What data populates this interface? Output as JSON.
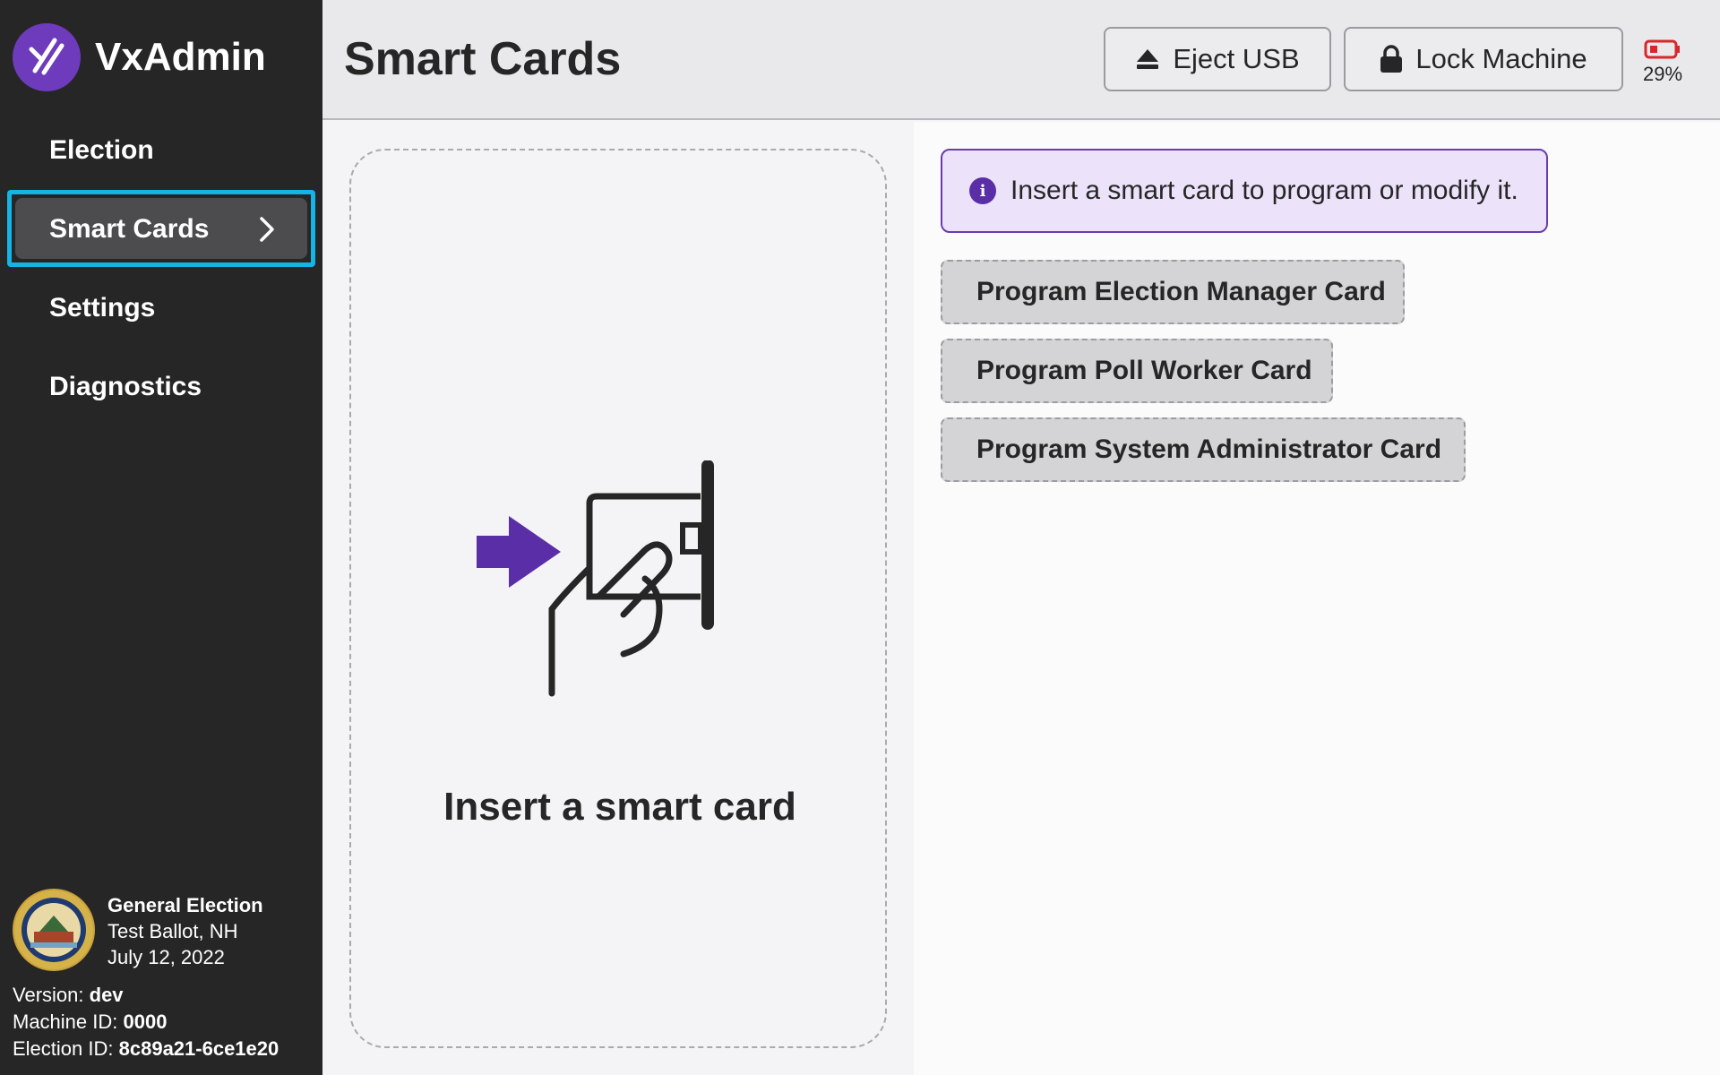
{
  "app": {
    "name": "VxAdmin"
  },
  "sidebar": {
    "items": [
      {
        "label": "Election"
      },
      {
        "label": "Smart Cards",
        "active": true
      },
      {
        "label": "Settings"
      },
      {
        "label": "Diagnostics"
      }
    ]
  },
  "election": {
    "title": "General Election",
    "ballot": "Test Ballot, NH",
    "date": "July 12, 2022"
  },
  "meta": {
    "version_label": "Version:",
    "version_value": "dev",
    "machine_label": "Machine ID:",
    "machine_value": "0000",
    "election_label": "Election ID:",
    "election_value": "8c89a21-6ce1e20"
  },
  "header": {
    "title": "Smart Cards",
    "eject_label": "Eject USB",
    "lock_label": "Lock Machine",
    "battery_pct": "29%"
  },
  "main": {
    "insert_prompt": "Insert a smart card",
    "callout_text": "Insert a smart card to program or modify it.",
    "buttons": [
      {
        "label": "Program Election Manager Card"
      },
      {
        "label": "Program Poll Worker Card"
      },
      {
        "label": "Program System Administrator Card"
      }
    ]
  },
  "colors": {
    "accent_purple": "#6d3bbb",
    "focus_outline": "#14b4e4",
    "battery_low": "#d9262c",
    "sidebar_bg": "#262626"
  },
  "icons": [
    "vx-logo-icon",
    "chevron-right-icon",
    "state-seal-icon",
    "eject-icon",
    "lock-icon",
    "battery-icon",
    "insert-card-icon",
    "info-icon"
  ]
}
